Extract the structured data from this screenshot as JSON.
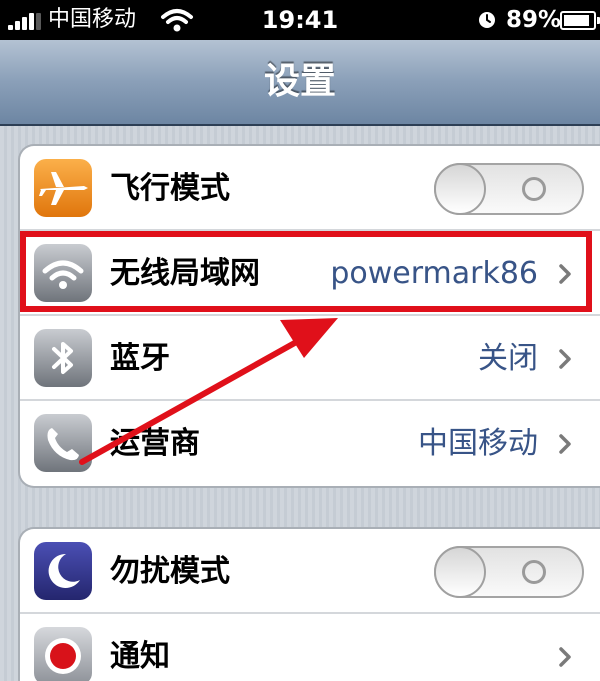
{
  "status_bar": {
    "signal_bars": 4,
    "carrier": "中国移动",
    "time": "19:41",
    "battery_percent": "89%",
    "battery_level": 0.89,
    "icons": [
      "signal-icon",
      "wifi-icon",
      "alarm-icon",
      "battery-icon"
    ]
  },
  "nav": {
    "title": "设置"
  },
  "groups": [
    {
      "rows": [
        {
          "label": "飞行模式",
          "icon": "airplane-icon",
          "control": "toggle",
          "toggle_state": "off"
        },
        {
          "label": "无线局域网",
          "icon": "wifi-icon",
          "value": "powermark86",
          "control": "chevron"
        },
        {
          "label": "蓝牙",
          "icon": "bluetooth-icon",
          "value": "关闭",
          "control": "chevron"
        },
        {
          "label": "运营商",
          "icon": "phone-icon",
          "value": "中国移动",
          "control": "chevron"
        }
      ]
    },
    {
      "rows": [
        {
          "label": "勿扰模式",
          "icon": "moon-icon",
          "control": "toggle",
          "toggle_state": "off"
        },
        {
          "label": "通知",
          "icon": "notifications-icon",
          "control": "chevron"
        }
      ]
    }
  ],
  "annotation": {
    "color": "#e0101a",
    "highlighted_row": "无线局域网"
  },
  "colors": {
    "value_text": "#385487",
    "nav_bar": "#8a9fb8",
    "background": "#c5ccd4"
  }
}
